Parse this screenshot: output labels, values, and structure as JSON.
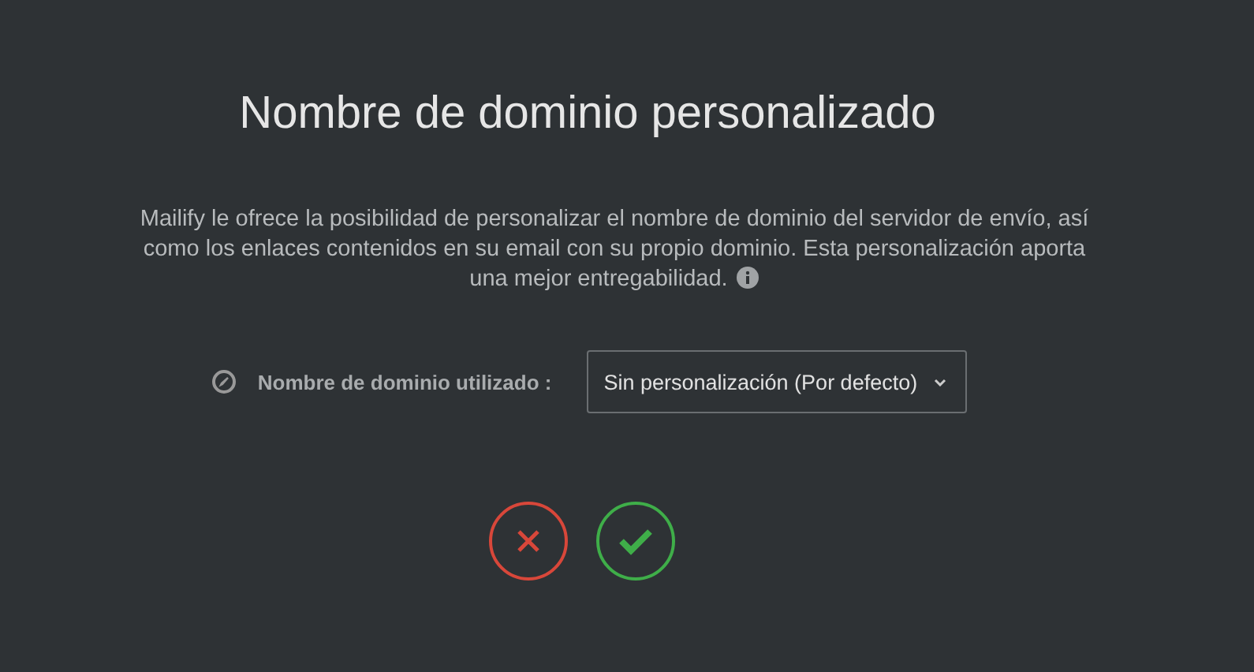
{
  "title": "Nombre de dominio personalizado",
  "description": "Mailify le ofrece la posibilidad de personalizar el nombre de dominio del servidor de envío, así como los enlaces contenidos en su email con su propio dominio. Esta personalización aporta una mejor entregabilidad.",
  "domain_field": {
    "label": "Nombre de dominio utilizado :",
    "value": "Sin personalización (Por defecto)"
  },
  "actions": [
    {
      "kind": "cancel"
    },
    {
      "kind": "confirm"
    }
  ]
}
